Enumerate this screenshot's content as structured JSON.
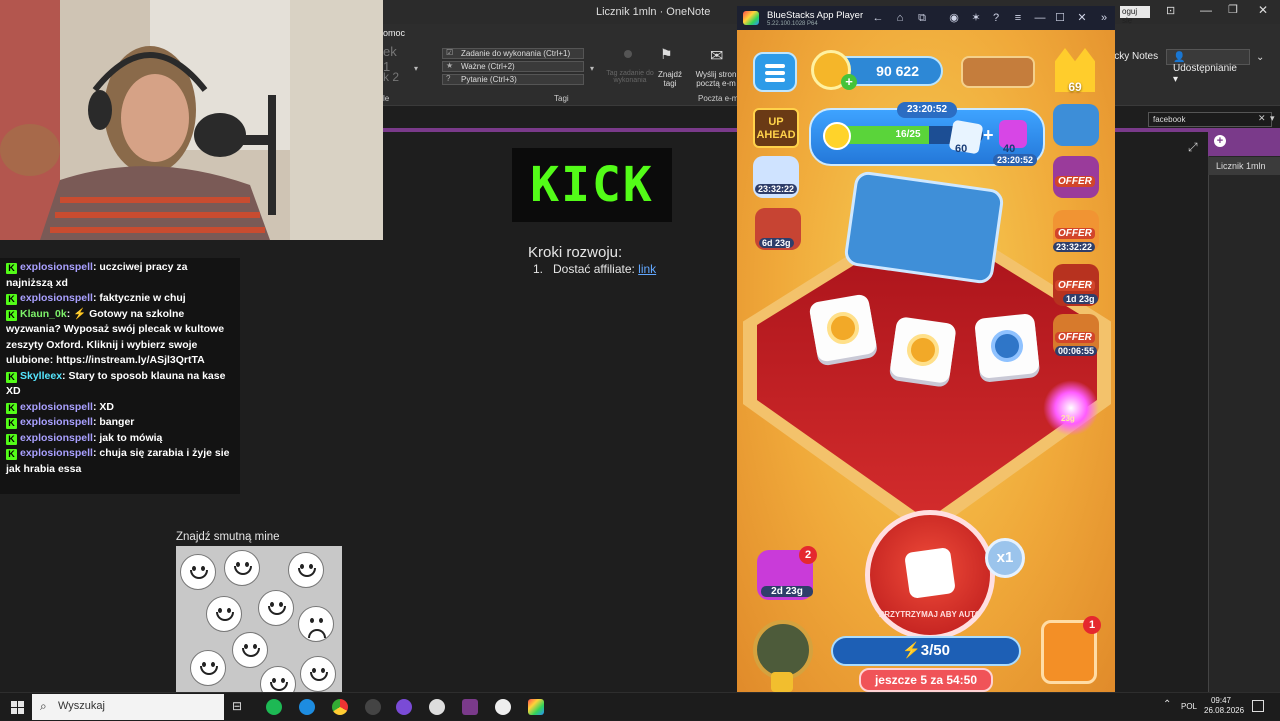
{
  "onenote": {
    "window_title": "Licznik 1mln  ·  OneNote",
    "menu_partial": "omoc",
    "login_label": "oguj się",
    "sticky_notes": "icky Notes",
    "share_label": "Udostępnianie",
    "tags": [
      "Zadanie do wykonania (Ctrl+1)",
      "Ważne (Ctrl+2)",
      "Pytanie (Ctrl+3)"
    ],
    "style_partial_1": "ek 1",
    "style_partial_2": "k 2",
    "tag_task_disabled": "Tag zadanie do wykonania",
    "find_tags": "Znajdź tagi",
    "send_email": "Wyślij stron pocztą e-m",
    "group_tags": "Tagi",
    "group_style": "le",
    "group_email": "Poczta e-ma",
    "search_value": "facebook",
    "page_list": [
      "Licznik 1mln"
    ],
    "kroki_title": "Kroki rozwoju:",
    "kroki_item_prefix": "Dostać affiliate: ",
    "kroki_item_link": "link",
    "kick_logo_text": "KICK"
  },
  "chat": {
    "messages": [
      {
        "user": "explosionspell",
        "text": "uczciwej pracy za najniższą xd",
        "user_color": "purple",
        "truncated": true
      },
      {
        "user": "explosionspell",
        "text": "faktycznie w chuj",
        "user_color": "purple"
      },
      {
        "user": "Klaun_0k",
        "text": "⚡ Gotowy na szkolne wyzwania? Wyposaż swój plecak w kultowe zeszyty Oxford. Kliknij i wybierz swoje ulubione: https://instream.ly/ASjl3QrtTA",
        "user_color": "green"
      },
      {
        "user": "Skylleex",
        "text": "Stary to sposob klauna na kase XD",
        "user_color": "cyan"
      },
      {
        "user": "explosionspell",
        "text": "XD",
        "user_color": "purple"
      },
      {
        "user": "explosionspell",
        "text": "banger",
        "user_color": "purple"
      },
      {
        "user": "explosionspell",
        "text": "jak to mówią",
        "user_color": "purple"
      },
      {
        "user": "explosionspell",
        "text": "chuja się zarabia i żyje sie jak hrabia essa",
        "user_color": "purple"
      }
    ]
  },
  "sad_widget": {
    "title": "Znajdź smutną mine"
  },
  "bluestacks": {
    "title": "BlueStacks App Player",
    "subtitle": "5.22.100.1028  P64",
    "game": {
      "coins": "90 622",
      "crown_level": "69",
      "progress_timer": "23:20:52",
      "progress_current": 16,
      "progress_total": 25,
      "progress_label": "16/25",
      "reward_a": "60",
      "reward_b": "40",
      "reward_timer": "23:20:52",
      "up_ahead": "UP AHEAD",
      "left_timer_1": "23:32:22",
      "left_timer_2": "6d 23g",
      "offer_label": "OFFER",
      "right_timer_1": "23:32:22",
      "right_timer_2": "1d 23g",
      "right_timer_3": "00:06:55",
      "roll_hint": "PRZYTRZYMAJ ABY AUTO",
      "multiplier": "x1",
      "energy": "3/50",
      "refill_text": "jeszcze 5 za 54:50",
      "puzzle_timer": "2d 23g",
      "puzzle_badge": "2",
      "hammer_badge": "1",
      "energy_small": "23g"
    }
  },
  "taskbar": {
    "search_placeholder": "Wyszukaj",
    "language": "POL",
    "time": "09:47",
    "date": "26.08.2026"
  },
  "colors": {
    "kick_green": "#53fc18",
    "onenote_purple": "#7a3a8a",
    "link_blue": "#62a7ff"
  }
}
